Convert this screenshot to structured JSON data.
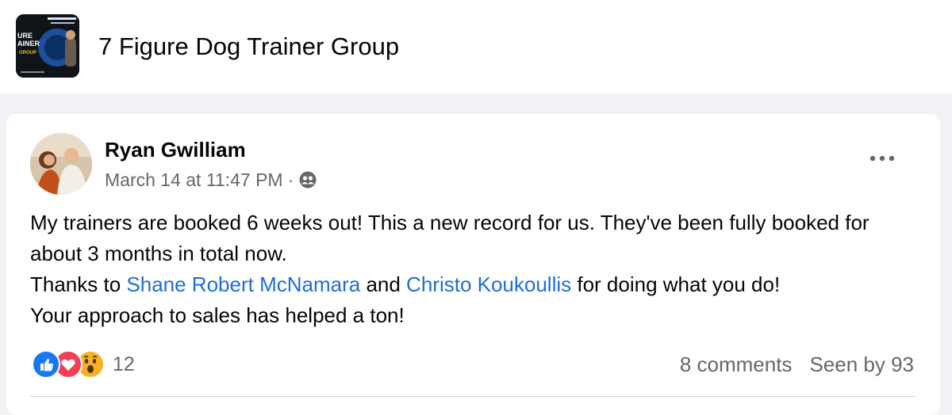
{
  "group": {
    "name": "7 Figure Dog Trainer Group",
    "thumb_text_line1": "URE",
    "thumb_text_line2": "AINER",
    "thumb_text_line3": "GROUP"
  },
  "post": {
    "author": "Ryan Gwilliam",
    "timestamp": "March 14 at 11:47 PM",
    "separator": "·",
    "audience_icon": "members-icon",
    "more_icon": "more-options-icon",
    "line1": "My trainers are booked 6 weeks out! This a new record for us. They've been fully booked for about 3 months in total now.",
    "line2_prefix": "Thanks to ",
    "mention1": "Shane Robert McNamara",
    "line2_mid": " and ",
    "mention2": "Christo Koukoullis",
    "line2_suffix": " for doing what you do!",
    "line3": "Your approach to sales has helped a ton!",
    "reactions": {
      "types": [
        "like-icon",
        "love-icon",
        "wow-icon"
      ],
      "count": "12"
    },
    "comments": "8 comments",
    "seen_by": "Seen by 93"
  },
  "colors": {
    "link": "#1f6ed4",
    "secondary_text": "#65676b",
    "like": "#1877f2",
    "love": "#f33e58",
    "wow": "#f7b125"
  }
}
